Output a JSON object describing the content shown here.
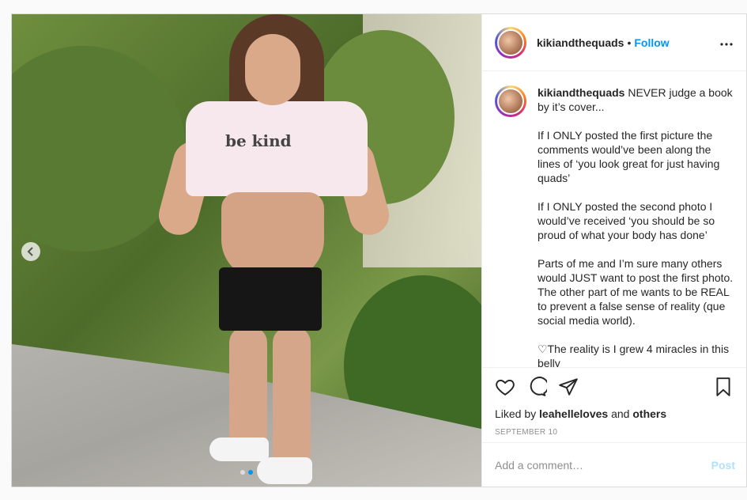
{
  "media": {
    "shirt_text": "be kind",
    "prev_icon": "chevron-left-icon",
    "slide_count": 2,
    "active_slide": 2
  },
  "header": {
    "username": "kikiandthequads",
    "separator": "•",
    "follow_label": "Follow",
    "more_icon": "more-horizontal-icon",
    "more_label": "•••"
  },
  "caption": {
    "username": "kikiandthequads",
    "text": " NEVER judge a book by it’s cover...\n\nIf I ONLY posted the first picture the comments would’ve been along the lines of ‘you look great for just having quads’\n\nIf I ONLY posted the second photo I would’ve received ‘you should be so proud of what your body has done’\n\nParts of me and I’m sure many others would JUST want to post the first photo. The other part of me wants to be REAL to prevent a false sense of reality (que social media world).\n\n♡The reality is I grew 4 miracles in this belly"
  },
  "actions": {
    "like_icon": "heart-icon",
    "comment_icon": "comment-icon",
    "share_icon": "share-icon",
    "save_icon": "bookmark-icon",
    "liked_prefix": "Liked by ",
    "liked_user": "leahelleloves",
    "liked_and": " and ",
    "liked_others": "others",
    "date": "SEPTEMBER 10"
  },
  "comment_box": {
    "placeholder": "Add a comment…",
    "post_label": "Post"
  },
  "colors": {
    "accent": "#0095f6",
    "post_disabled": "#b2dffc",
    "border": "#dbdbdb",
    "muted": "#8e8e8e"
  }
}
